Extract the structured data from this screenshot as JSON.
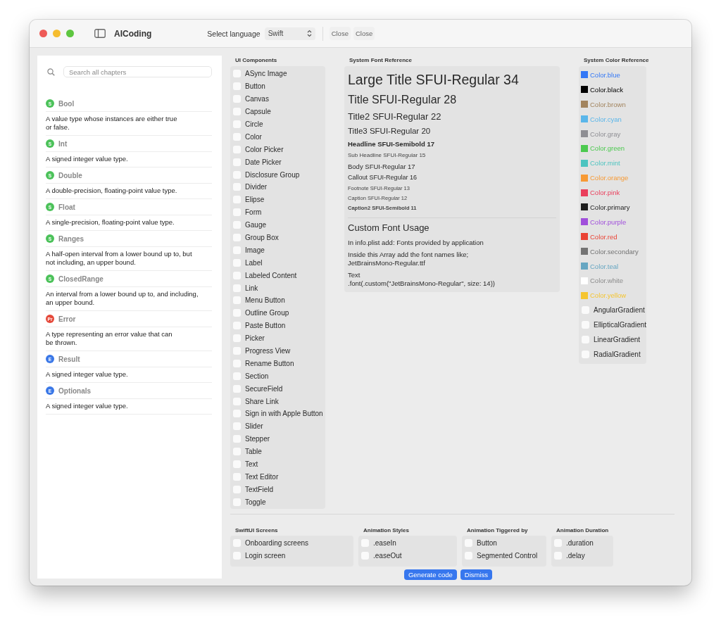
{
  "window": {
    "title": "AICoding"
  },
  "toolbar": {
    "language_label": "Select language",
    "language": "Swift",
    "buttons": [
      "Close",
      "Close"
    ]
  },
  "sidebar": {
    "search": {
      "placeholder": "Search all chapters"
    },
    "chapters": [
      {
        "badge": "S",
        "color": "#4cc25a",
        "title": "Bool",
        "description": "A value type whose instances are either true\nor false."
      },
      {
        "badge": "S",
        "color": "#4cc25a",
        "title": "Int",
        "description": "A signed integer value type."
      },
      {
        "badge": "S",
        "color": "#4cc25a",
        "title": "Double",
        "description": "A double-precision, floating-point value type."
      },
      {
        "badge": "S",
        "color": "#4cc25a",
        "title": "Float",
        "description": "A single-precision, floating-point value type."
      },
      {
        "badge": "S",
        "color": "#4cc25a",
        "title": "Ranges",
        "description": "A half-open interval from a lower bound up to, but\nnot including, an upper bound."
      },
      {
        "badge": "S",
        "color": "#4cc25a",
        "title": "ClosedRange",
        "description": "An interval from a lower bound up to, and including,\nan upper bound."
      },
      {
        "badge": "Pr",
        "color": "#e5493a",
        "title": "Error",
        "description": "A type representing an error value that can\nbe thrown."
      },
      {
        "badge": "E",
        "color": "#3b78e7",
        "title": "Result",
        "description": "A signed integer value type."
      },
      {
        "badge": "E",
        "color": "#3b78e7",
        "title": "Optionals",
        "description": "A signed integer value type."
      }
    ]
  },
  "ui_components": {
    "title": "UI Components",
    "items": [
      {
        "label": "ASync Image",
        "checked": false
      },
      {
        "label": "Button",
        "checked": false
      },
      {
        "label": "Canvas",
        "checked": false
      },
      {
        "label": "Capsule",
        "checked": false
      },
      {
        "label": "Circle",
        "checked": false
      },
      {
        "label": "Color",
        "checked": false
      },
      {
        "label": "Color Picker",
        "checked": false
      },
      {
        "label": "Date Picker",
        "checked": false
      },
      {
        "label": "Disclosure Group",
        "checked": false
      },
      {
        "label": "Divider",
        "checked": false
      },
      {
        "label": "Elipse",
        "checked": false
      },
      {
        "label": "Form",
        "checked": false
      },
      {
        "label": "Gauge",
        "checked": false
      },
      {
        "label": "Group Box",
        "checked": false
      },
      {
        "label": "Image",
        "checked": false
      },
      {
        "label": "Label",
        "checked": false
      },
      {
        "label": "Labeled Content",
        "checked": false
      },
      {
        "label": "Link",
        "checked": false
      },
      {
        "label": "Menu Button",
        "checked": false
      },
      {
        "label": "Outline Group",
        "checked": false
      },
      {
        "label": "Paste Button",
        "checked": false
      },
      {
        "label": "Picker",
        "checked": false
      },
      {
        "label": "Progress View",
        "checked": false
      },
      {
        "label": "Rename Button",
        "checked": false
      },
      {
        "label": "Section",
        "checked": false
      },
      {
        "label": "SecureField",
        "checked": false
      },
      {
        "label": "Share Link",
        "checked": false
      },
      {
        "label": "Sign in with Apple Button",
        "checked": false
      },
      {
        "label": "Slider",
        "checked": false
      },
      {
        "label": "Stepper",
        "checked": false
      },
      {
        "label": "Table",
        "checked": false
      },
      {
        "label": "Text",
        "checked": false
      },
      {
        "label": "Text Editor",
        "checked": false
      },
      {
        "label": "TextField",
        "checked": false
      },
      {
        "label": "Toggle",
        "checked": false
      }
    ]
  },
  "font_reference": {
    "title": "System Font Reference",
    "samples": [
      {
        "text": "Large Title SFUI-Regular 34"
      },
      {
        "text": "Title SFUI-Regular 28"
      },
      {
        "text": "Title2 SFUI-Regular 22"
      },
      {
        "text": "Title3 SFUI-Regular 20"
      },
      {
        "text": "Headline SFUI-Semibold 17"
      },
      {
        "text": "Sub Headline SFUI-Regular 15"
      },
      {
        "text": "Body SFUI-Regular 17"
      },
      {
        "text": "Callout SFUI-Regular 16"
      },
      {
        "text": "Footnote SFUI-Regular 13"
      },
      {
        "text": "Caption SFUI-Regular 12"
      },
      {
        "text": "Caption2 SFUI-Semibold 11"
      }
    ],
    "custom": {
      "title": "Custom Font Usage",
      "lines": [
        "In info.plist add: Fonts provided by application",
        "Inside this Array add the font names like;\nJetBrainsMono-Regular.ttf",
        "Text\n.font(.custom(\"JetBrainsMono-Regular\", size: 14))"
      ]
    }
  },
  "color_reference": {
    "title": "System Color Reference",
    "items": [
      {
        "kind": "swatch",
        "label": "Color.blue",
        "color": "#3478f6"
      },
      {
        "kind": "swatch",
        "label": "Color.black",
        "color": "#000000"
      },
      {
        "kind": "swatch",
        "label": "Color.brown",
        "color": "#a2845e"
      },
      {
        "kind": "swatch",
        "label": "Color.cyan",
        "color": "#5ab6ea"
      },
      {
        "kind": "swatch",
        "label": "Color.gray",
        "color": "#8e8e93"
      },
      {
        "kind": "swatch",
        "label": "Color.green",
        "color": "#4cc94f"
      },
      {
        "kind": "swatch",
        "label": "Color.mint",
        "color": "#4dc4c0"
      },
      {
        "kind": "swatch",
        "label": "Color.orange",
        "color": "#f79a35"
      },
      {
        "kind": "swatch",
        "label": "Color.pink",
        "color": "#ea3f5c"
      },
      {
        "kind": "swatch",
        "label": "Color.primary",
        "color": "#1e1e1e"
      },
      {
        "kind": "swatch",
        "label": "Color.purple",
        "color": "#a04fdb"
      },
      {
        "kind": "swatch",
        "label": "Color.red",
        "color": "#ea4335"
      },
      {
        "kind": "swatch",
        "label": "Color.secondary",
        "color": "#737373"
      },
      {
        "kind": "swatch",
        "label": "Color.teal",
        "color": "#66a6c2"
      },
      {
        "kind": "swatch",
        "label": "Color.white",
        "color": "#ffffff"
      },
      {
        "kind": "swatch",
        "label": "Color.yellow",
        "color": "#f5c531"
      },
      {
        "kind": "checkbox",
        "label": "AngularGradient",
        "checked": false
      },
      {
        "kind": "checkbox",
        "label": "EllipticalGradient",
        "checked": false
      },
      {
        "kind": "checkbox",
        "label": "LinearGradient",
        "checked": false
      },
      {
        "kind": "checkbox",
        "label": "RadialGradient",
        "checked": false
      }
    ]
  },
  "bottom_groups": [
    {
      "title": "SwiftUI Screens",
      "items": [
        {
          "label": "Onboarding screens",
          "checked": false
        },
        {
          "label": "Login screen",
          "checked": false
        }
      ]
    },
    {
      "title": "Animation Styles",
      "items": [
        {
          "label": ".easeIn",
          "checked": false
        },
        {
          "label": ".easeOut",
          "checked": false
        }
      ]
    },
    {
      "title": "Animation Tiggered by",
      "items": [
        {
          "label": "Button",
          "checked": false
        },
        {
          "label": "Segmented Control",
          "checked": false
        }
      ]
    },
    {
      "title": "Animation Duration",
      "items": [
        {
          "label": ".duration",
          "checked": false
        },
        {
          "label": ".delay",
          "checked": false
        }
      ]
    }
  ],
  "actions": [
    "Generate code",
    "Dismiss"
  ]
}
